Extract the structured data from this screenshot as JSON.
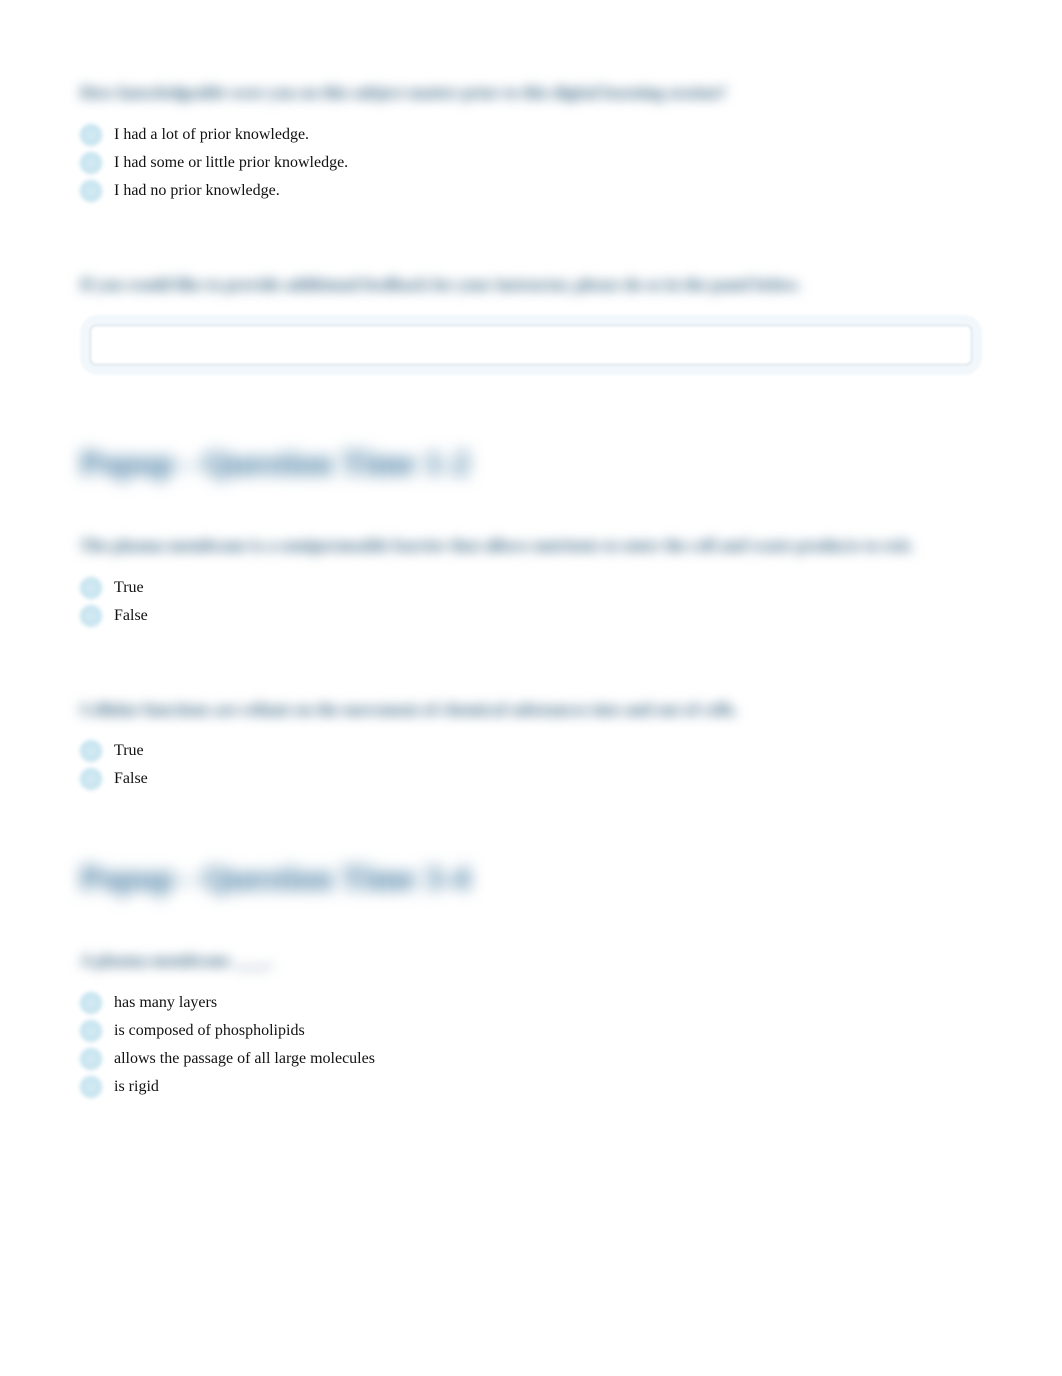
{
  "q1": {
    "prompt": "How knowledgeable were you on this subject matter prior to this digital learning session?",
    "options": [
      "I had a lot of prior knowledge.",
      "I had some or little prior knowledge.",
      "I had no prior knowledge."
    ]
  },
  "q2": {
    "prompt": "If you would like to provide additional feedback for your instructor, please do so in the panel below.",
    "value": ""
  },
  "section1": {
    "title": "Popup - Question Time 1-2"
  },
  "q3": {
    "prompt": "The plasma membrane is a semipermeable barrier that allows nutrients to enter the cell and waste products to exit.",
    "options": [
      "True",
      "False"
    ]
  },
  "q4": {
    "prompt": "Cellular functions are reliant on the movement of chemical substances into and out of cells.",
    "options": [
      "True",
      "False"
    ]
  },
  "section2": {
    "title": "Popup - Question Time 3-4"
  },
  "q5": {
    "prompt": "A plasma membrane ____.",
    "options": [
      "has many layers",
      "is composed of phospholipids",
      "allows the passage of all large molecules",
      "is rigid"
    ]
  }
}
